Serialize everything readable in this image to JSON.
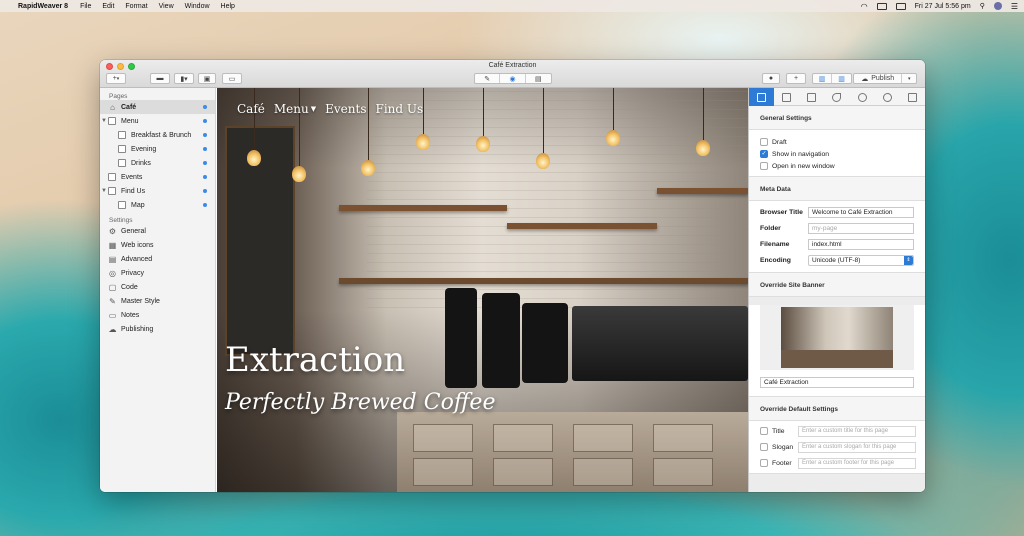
{
  "menubar": {
    "app": "RapidWeaver 8",
    "items": [
      "File",
      "Edit",
      "Format",
      "View",
      "Window",
      "Help"
    ],
    "clock": "Fri 27 Jul  5:56 pm"
  },
  "window": {
    "title": "Café Extraction",
    "toolbar": {
      "add": "+",
      "publish": "Publish"
    }
  },
  "sidebar": {
    "pages_header": "Pages",
    "pages": [
      {
        "label": "Café",
        "level": 0
      },
      {
        "label": "Menu",
        "level": 0
      },
      {
        "label": "Breakfast & Brunch",
        "level": 1
      },
      {
        "label": "Evening",
        "level": 1
      },
      {
        "label": "Drinks",
        "level": 1
      },
      {
        "label": "Events",
        "level": 0
      },
      {
        "label": "Find Us",
        "level": 0
      },
      {
        "label": "Map",
        "level": 1
      }
    ],
    "settings_header": "Settings",
    "settings": [
      {
        "label": "General",
        "icon": "gear-icon"
      },
      {
        "label": "Web icons",
        "icon": "web-icons-icon"
      },
      {
        "label": "Advanced",
        "icon": "advanced-icon"
      },
      {
        "label": "Privacy",
        "icon": "privacy-icon"
      },
      {
        "label": "Code",
        "icon": "code-icon"
      },
      {
        "label": "Master Style",
        "icon": "master-style-icon"
      },
      {
        "label": "Notes",
        "icon": "notes-icon"
      },
      {
        "label": "Publishing",
        "icon": "cloud-icon"
      }
    ]
  },
  "preview": {
    "nav": [
      "Café",
      "Menu",
      "Events",
      "Find Us"
    ],
    "title": "Extraction",
    "subtitle": "Perfectly Brewed Coffee"
  },
  "inspector": {
    "general_header": "General Settings",
    "draft": "Draft",
    "show_in_nav": "Show in navigation",
    "open_new_window": "Open in new window",
    "meta_header": "Meta Data",
    "browser_title_label": "Browser Title",
    "browser_title_value": "Welcome to Café Extraction",
    "folder_label": "Folder",
    "folder_placeholder": "my-page",
    "filename_label": "Filename",
    "filename_value": "index.html",
    "encoding_label": "Encoding",
    "encoding_value": "Unicode (UTF-8)",
    "banner_header": "Override Site Banner",
    "banner_caption": "Café Extraction",
    "override_header": "Override Default Settings",
    "ov_title": "Title",
    "ov_title_ph": "Enter a custom title for this page",
    "ov_slogan": "Slogan",
    "ov_slogan_ph": "Enter a custom slogan for this page",
    "ov_footer": "Footer",
    "ov_footer_ph": "Enter a custom footer for this page"
  },
  "colors": {
    "accent": "#2e7bd6",
    "indicator": "#3d8be8"
  }
}
